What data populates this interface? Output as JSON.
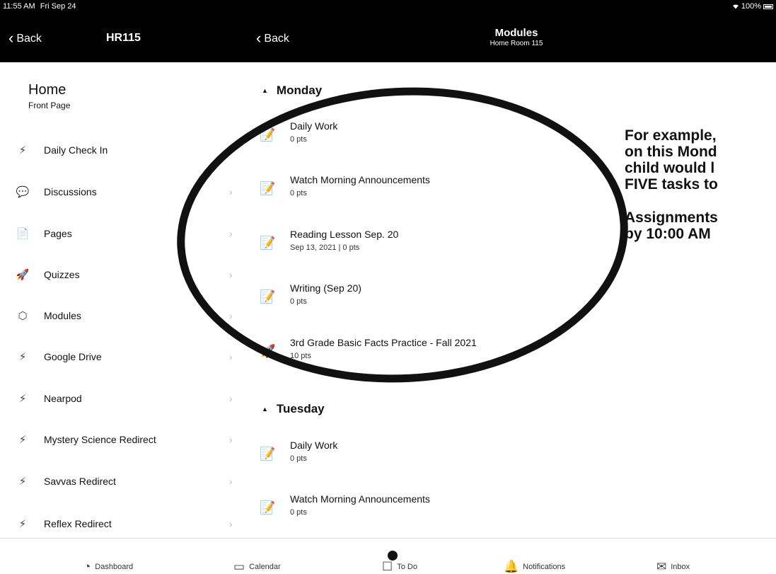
{
  "status_bar": {
    "time": "11:55 AM",
    "date": "Fri Sep 24",
    "battery": "100%"
  },
  "left_nav": {
    "back_label": "Back",
    "course": "HR115"
  },
  "right_nav": {
    "back_label": "Back",
    "title": "Modules",
    "subtitle": "Home Room 115"
  },
  "sidebar": {
    "home_title": "Home",
    "home_subtitle": "Front Page",
    "items": [
      {
        "label": "Daily Check In",
        "icon": "plug-icon"
      },
      {
        "label": "Discussions",
        "icon": "discussions-icon"
      },
      {
        "label": "Pages",
        "icon": "page-icon"
      },
      {
        "label": "Quizzes",
        "icon": "rocket-icon"
      },
      {
        "label": "Modules",
        "icon": "modules-icon"
      },
      {
        "label": "Google Drive",
        "icon": "plug-icon"
      },
      {
        "label": "Nearpod",
        "icon": "plug-icon"
      },
      {
        "label": "Mystery Science Redirect",
        "icon": "plug-icon"
      },
      {
        "label": "Savvas Redirect",
        "icon": "plug-icon"
      },
      {
        "label": "Reflex Redirect",
        "icon": "plug-icon"
      }
    ]
  },
  "modules": [
    {
      "name": "Monday",
      "items": [
        {
          "title": "Daily Work",
          "sub": "0 pts",
          "icon": "assignment-icon"
        },
        {
          "title": "Watch Morning Announcements",
          "sub": "0 pts",
          "icon": "assignment-icon"
        },
        {
          "title": "Reading Lesson Sep. 20",
          "sub": "Sep 13, 2021 | 0 pts",
          "icon": "assignment-icon"
        },
        {
          "title": "Writing (Sep 20)",
          "sub": "0 pts",
          "icon": "assignment-icon"
        },
        {
          "title": "3rd Grade Basic Facts Practice - Fall 2021",
          "sub": "10 pts",
          "icon": "rocket-icon"
        }
      ]
    },
    {
      "name": "Tuesday",
      "items": [
        {
          "title": "Daily Work",
          "sub": "0 pts",
          "icon": "assignment-icon"
        },
        {
          "title": "Watch Morning Announcements",
          "sub": "0 pts",
          "icon": "assignment-icon"
        }
      ]
    }
  ],
  "callout": {
    "lines_1": [
      "For example,",
      "on this Mond",
      "child would l",
      "FIVE tasks to"
    ],
    "lines_2": [
      "Assignments",
      "by 10:00 AM"
    ]
  },
  "tabbar": {
    "items": [
      {
        "label": "Dashboard",
        "icon": "dashboard-icon"
      },
      {
        "label": "Calendar",
        "icon": "calendar-icon"
      },
      {
        "label": "To Do",
        "icon": "todo-icon"
      },
      {
        "label": "Notifications",
        "icon": "bell-icon"
      },
      {
        "label": "Inbox",
        "icon": "inbox-icon"
      }
    ]
  }
}
